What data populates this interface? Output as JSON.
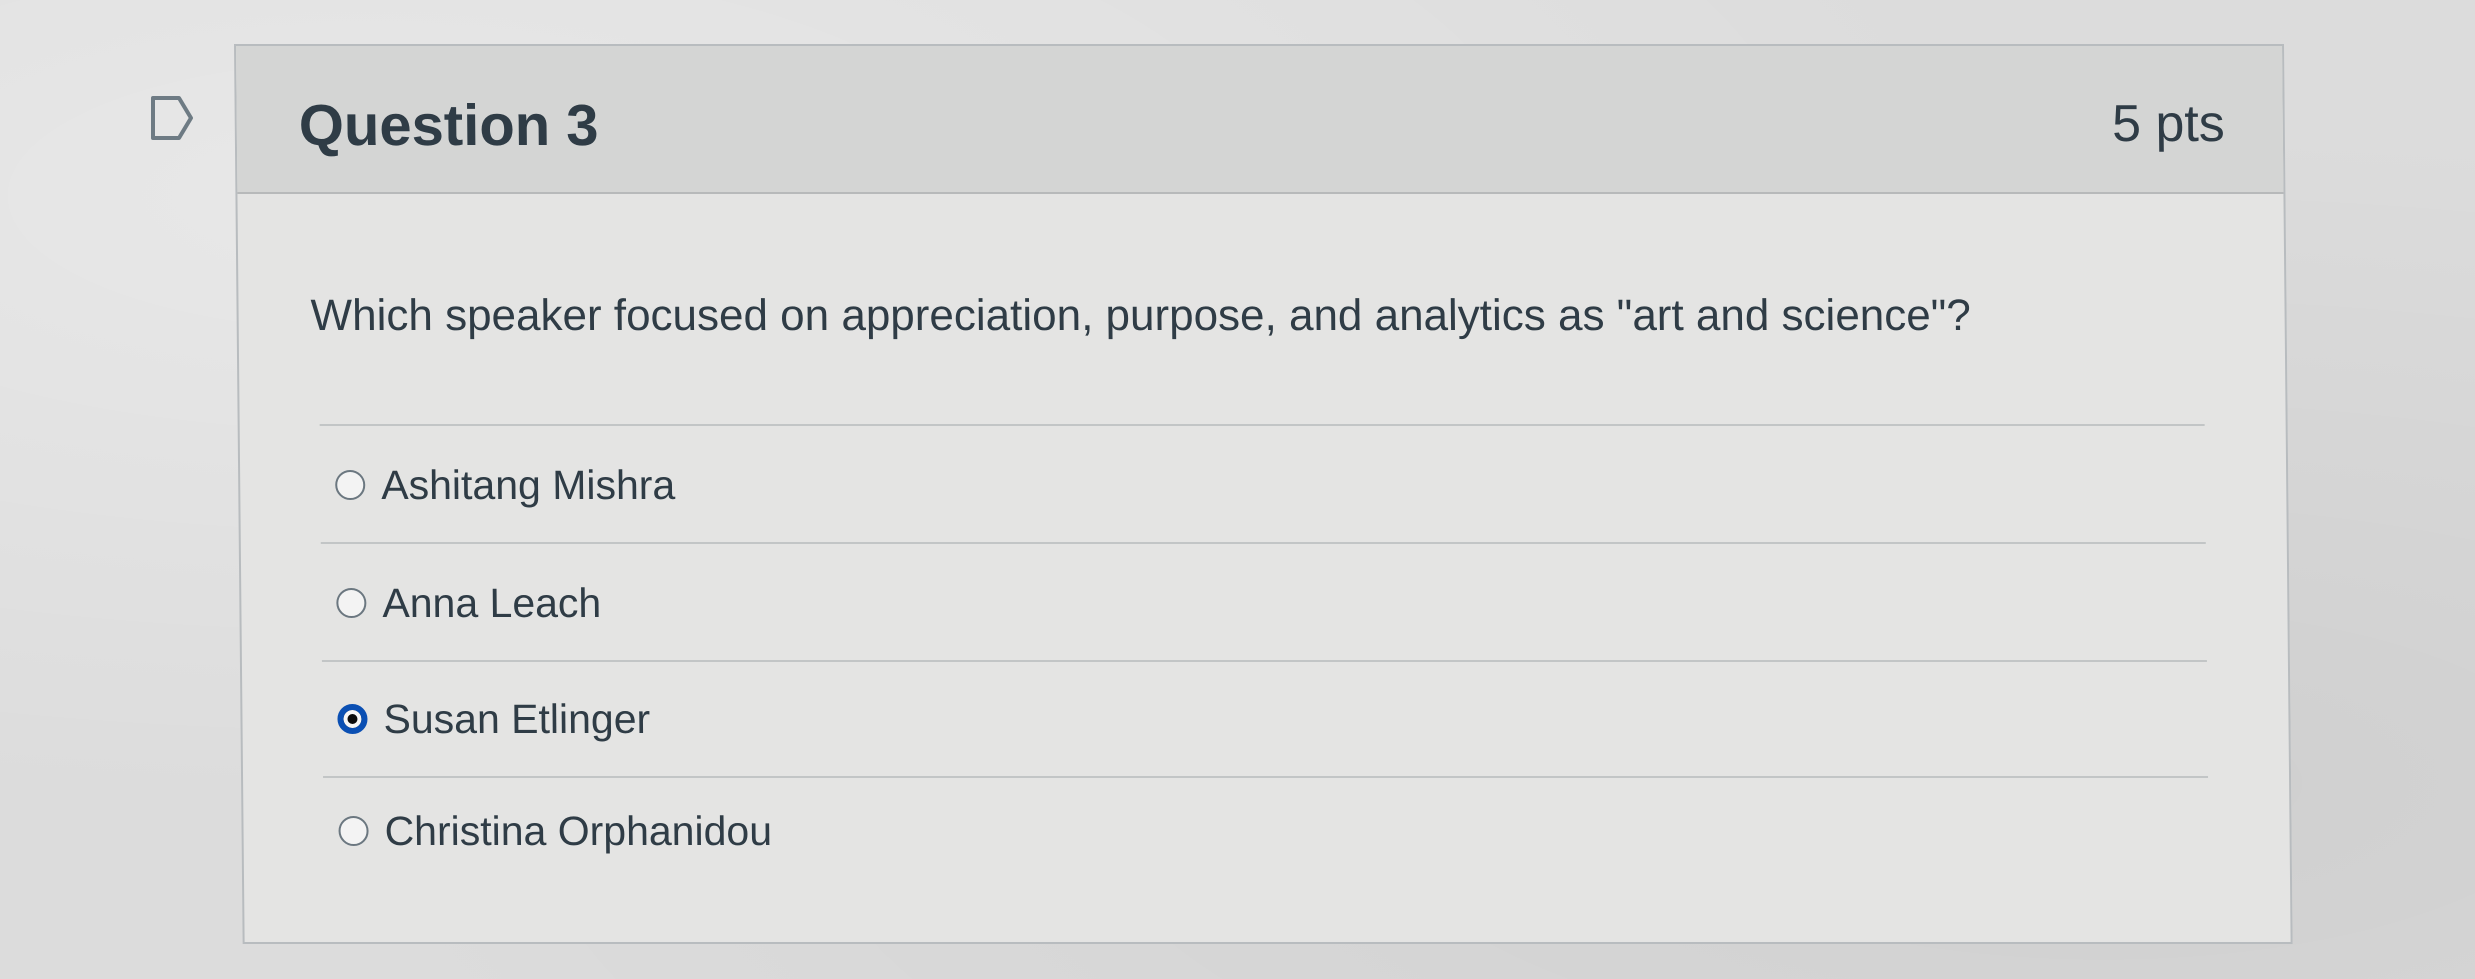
{
  "question": {
    "title": "Question 3",
    "points": "5 pts",
    "text": "Which speaker focused on appreciation, purpose, and analytics as \"art and science\"?",
    "answers": [
      {
        "label": "Ashitang Mishra",
        "selected": false
      },
      {
        "label": "Anna Leach",
        "selected": false
      },
      {
        "label": "Susan Etlinger",
        "selected": true
      },
      {
        "label": "Christina Orphanidou",
        "selected": false
      }
    ]
  },
  "colors": {
    "selected_radio": "#0a4fb3",
    "text": "#2f3c46",
    "header_bg": "#d4d5d4"
  },
  "icons": {
    "flag": "flag-question-icon"
  }
}
